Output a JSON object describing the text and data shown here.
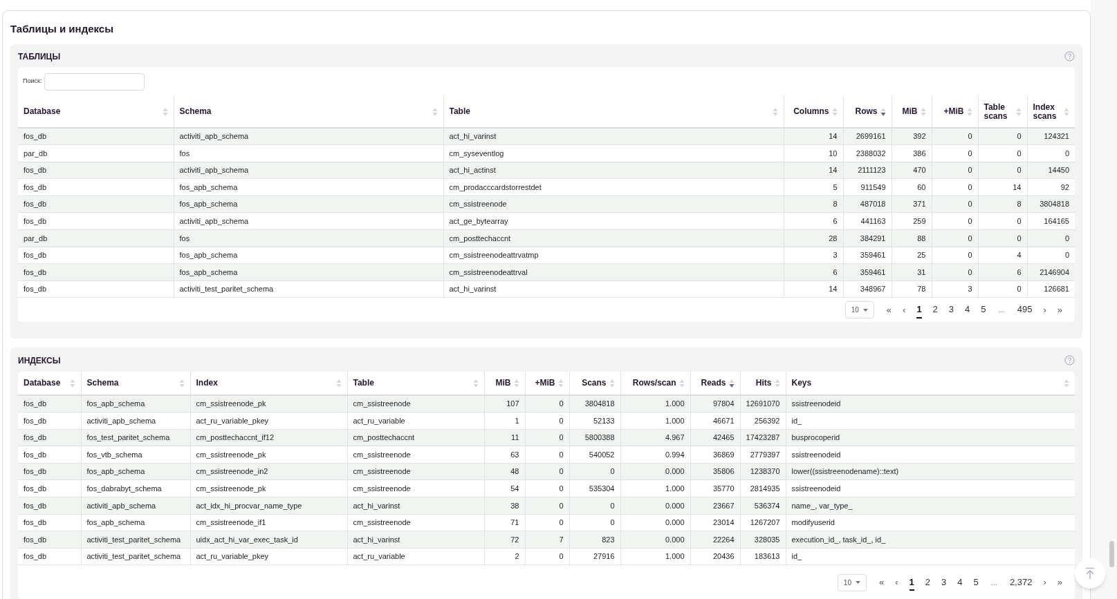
{
  "page_title": "Таблицы и индексы",
  "tables_panel": {
    "title": "ТАБЛИЦЫ",
    "search": {
      "label": "Поиск:"
    },
    "columns": [
      {
        "label": "Database",
        "kind": "text",
        "sorted_desc": false
      },
      {
        "label": "Schema",
        "kind": "text",
        "sorted_desc": false
      },
      {
        "label": "Table",
        "kind": "text",
        "sorted_desc": false
      },
      {
        "label": "Columns",
        "kind": "number",
        "sorted_desc": false
      },
      {
        "label": "Rows",
        "kind": "number",
        "sorted_desc": true
      },
      {
        "label": "MiB",
        "kind": "number",
        "sorted_desc": false
      },
      {
        "label": "+MiB",
        "kind": "number",
        "sorted_desc": false
      },
      {
        "label": "Table scans",
        "kind": "number",
        "sorted_desc": false
      },
      {
        "label": "Index scans",
        "kind": "number",
        "sorted_desc": false
      }
    ],
    "rows": [
      [
        "fos_db",
        "activiti_apb_schema",
        "act_hi_varinst",
        "14",
        "2699161",
        "392",
        "0",
        "0",
        "124321"
      ],
      [
        "par_db",
        "fos",
        "cm_syseventlog",
        "10",
        "2388032",
        "386",
        "0",
        "0",
        "0"
      ],
      [
        "fos_db",
        "activiti_apb_schema",
        "act_hi_actinst",
        "14",
        "2111123",
        "470",
        "0",
        "0",
        "14450"
      ],
      [
        "fos_db",
        "fos_apb_schema",
        "cm_prodacccardstorrestdet",
        "5",
        "911549",
        "60",
        "0",
        "14",
        "92"
      ],
      [
        "fos_db",
        "fos_apb_schema",
        "cm_ssistreenode",
        "8",
        "487018",
        "371",
        "0",
        "8",
        "3804818"
      ],
      [
        "fos_db",
        "activiti_apb_schema",
        "act_ge_bytearray",
        "6",
        "441163",
        "259",
        "0",
        "0",
        "164165"
      ],
      [
        "par_db",
        "fos",
        "cm_posttechaccnt",
        "28",
        "384291",
        "88",
        "0",
        "0",
        "0"
      ],
      [
        "fos_db",
        "fos_apb_schema",
        "cm_ssistreenodeattrvatmp",
        "3",
        "359461",
        "25",
        "0",
        "4",
        "0"
      ],
      [
        "fos_db",
        "fos_apb_schema",
        "cm_ssistreenodeattrval",
        "6",
        "359461",
        "31",
        "0",
        "6",
        "2146904"
      ],
      [
        "fos_db",
        "activiti_test_paritet_schema",
        "act_hi_varinst",
        "14",
        "348967",
        "78",
        "3",
        "0",
        "126681"
      ]
    ],
    "pagination": {
      "page_size": "10",
      "first": "«",
      "prev": "‹",
      "pages": [
        {
          "label": "1",
          "kind": "page",
          "selected": true
        },
        {
          "label": "2",
          "kind": "page",
          "selected": false
        },
        {
          "label": "3",
          "kind": "page",
          "selected": false
        },
        {
          "label": "4",
          "kind": "page",
          "selected": false
        },
        {
          "label": "5",
          "kind": "page",
          "selected": false
        },
        {
          "label": "...",
          "kind": "gap"
        },
        {
          "label": "495",
          "kind": "page",
          "selected": false
        }
      ],
      "next": "›",
      "last": "»"
    }
  },
  "indexes_panel": {
    "title": "ИНДЕКСЫ",
    "columns": [
      {
        "label": "Database",
        "kind": "text",
        "sorted_desc": false
      },
      {
        "label": "Schema",
        "kind": "text",
        "sorted_desc": false
      },
      {
        "label": "Index",
        "kind": "text",
        "sorted_desc": false
      },
      {
        "label": "Table",
        "kind": "text",
        "sorted_desc": false
      },
      {
        "label": "MiB",
        "kind": "number",
        "sorted_desc": false
      },
      {
        "label": "+MiB",
        "kind": "number",
        "sorted_desc": false
      },
      {
        "label": "Scans",
        "kind": "number",
        "sorted_desc": false
      },
      {
        "label": "Rows/scan",
        "kind": "number",
        "sorted_desc": false
      },
      {
        "label": "Reads",
        "kind": "number",
        "sorted_desc": true
      },
      {
        "label": "Hits",
        "kind": "number",
        "sorted_desc": false
      },
      {
        "label": "Keys",
        "kind": "text",
        "sorted_desc": false
      }
    ],
    "rows": [
      [
        "fos_db",
        "fos_apb_schema",
        "cm_ssistreenode_pk",
        "cm_ssistreenode",
        "107",
        "0",
        "3804818",
        "1.000",
        "97804",
        "12691070",
        "ssistreenodeid"
      ],
      [
        "fos_db",
        "activiti_apb_schema",
        "act_ru_variable_pkey",
        "act_ru_variable",
        "1",
        "0",
        "52133",
        "1.000",
        "46671",
        "256392",
        "id_"
      ],
      [
        "fos_db",
        "fos_test_paritet_schema",
        "cm_posttechaccnt_if12",
        "cm_posttechaccnt",
        "11",
        "0",
        "5800388",
        "4.967",
        "42465",
        "17423287",
        "busprocoperid"
      ],
      [
        "fos_db",
        "fos_vtb_schema",
        "cm_ssistreenode_pk",
        "cm_ssistreenode",
        "63",
        "0",
        "540052",
        "0.994",
        "36869",
        "2779397",
        "ssistreenodeid"
      ],
      [
        "fos_db",
        "fos_apb_schema",
        "cm_ssistreenode_in2",
        "cm_ssistreenode",
        "48",
        "0",
        "0",
        "0.000",
        "35806",
        "1238370",
        "lower((ssistreenodename)::text)"
      ],
      [
        "fos_db",
        "fos_dabrabyt_schema",
        "cm_ssistreenode_pk",
        "cm_ssistreenode",
        "54",
        "0",
        "535304",
        "1.000",
        "35770",
        "2814935",
        "ssistreenodeid"
      ],
      [
        "fos_db",
        "activiti_apb_schema",
        "act_idx_hi_procvar_name_type",
        "act_hi_varinst",
        "38",
        "0",
        "0",
        "0.000",
        "23667",
        "536374",
        "name_, var_type_"
      ],
      [
        "fos_db",
        "fos_apb_schema",
        "cm_ssistreenode_if1",
        "cm_ssistreenode",
        "71",
        "0",
        "0",
        "0.000",
        "23014",
        "1267207",
        "modifyuserid"
      ],
      [
        "fos_db",
        "activiti_test_paritet_schema",
        "uidx_act_hi_var_exec_task_id",
        "act_hi_varinst",
        "72",
        "7",
        "823",
        "0.000",
        "22264",
        "328035",
        "execution_id_, task_id_, id_"
      ],
      [
        "fos_db",
        "activiti_test_paritet_schema",
        "act_ru_variable_pkey",
        "act_ru_variable",
        "2",
        "0",
        "27916",
        "1.000",
        "20436",
        "183613",
        "id_"
      ]
    ],
    "pagination": {
      "page_size": "10",
      "first": "«",
      "prev": "‹",
      "pages": [
        {
          "label": "1",
          "kind": "page",
          "selected": true
        },
        {
          "label": "2",
          "kind": "page",
          "selected": false
        },
        {
          "label": "3",
          "kind": "page",
          "selected": false
        },
        {
          "label": "4",
          "kind": "page",
          "selected": false
        },
        {
          "label": "5",
          "kind": "page",
          "selected": false
        },
        {
          "label": "...",
          "kind": "gap"
        },
        {
          "label": "2,372",
          "kind": "page",
          "selected": false
        }
      ],
      "next": "›",
      "last": "»"
    }
  }
}
